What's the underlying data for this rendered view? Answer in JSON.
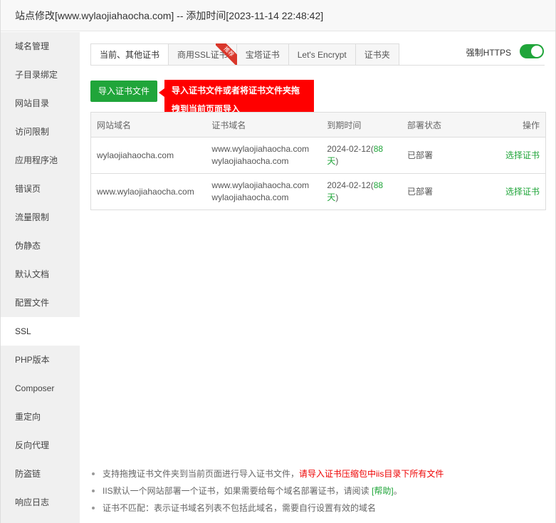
{
  "window": {
    "title": "站点修改[www.wylaojiahaocha.com] -- 添加时间[2023-11-14 22:48:42]"
  },
  "sidebar": {
    "items": [
      {
        "label": "域名管理"
      },
      {
        "label": "子目录绑定"
      },
      {
        "label": "网站目录"
      },
      {
        "label": "访问限制"
      },
      {
        "label": "应用程序池"
      },
      {
        "label": "错误页"
      },
      {
        "label": "流量限制"
      },
      {
        "label": "伪静态"
      },
      {
        "label": "默认文档"
      },
      {
        "label": "配置文件"
      },
      {
        "label": "SSL"
      },
      {
        "label": "PHP版本"
      },
      {
        "label": "Composer"
      },
      {
        "label": "重定向"
      },
      {
        "label": "反向代理"
      },
      {
        "label": "防盗链"
      },
      {
        "label": "响应日志"
      }
    ],
    "active": "SSL"
  },
  "tabs": [
    {
      "label": "当前、其他证书"
    },
    {
      "label": "商用SSL证书",
      "badge": "推荐"
    },
    {
      "label": "宝塔证书"
    },
    {
      "label": "Let's Encrypt"
    },
    {
      "label": "证书夹"
    }
  ],
  "https_toggle": {
    "label": "强制HTTPS",
    "enabled": true
  },
  "import_button": {
    "label": "导入证书文件"
  },
  "tooltip": {
    "line1": "导入证书文件或者将证书文件夹拖",
    "line2": "拽到当前页面导入"
  },
  "table": {
    "headers": {
      "site": "网站域名",
      "cert": "证书域名",
      "expire": "到期时间",
      "status": "部署状态",
      "op": "操作"
    },
    "rows": [
      {
        "site": "wylaojiahaocha.com",
        "cert1": "www.wylaojiahaocha.com",
        "cert2": "wylaojiahaocha.com",
        "expire_date": "2024-02-12(",
        "days": "88",
        "day_unit": "天",
        "close": ")",
        "status": "已部署",
        "op": "选择证书"
      },
      {
        "site": "www.wylaojiahaocha.com",
        "cert1": "www.wylaojiahaocha.com",
        "cert2": "wylaojiahaocha.com",
        "expire_date": "2024-02-12(",
        "days": "88",
        "day_unit": "天",
        "close": ")",
        "status": "已部署",
        "op": "选择证书"
      }
    ]
  },
  "notes": {
    "n1_text": "支持拖拽证书文件夹到当前页面进行导入证书文件，",
    "n1_red": "请导入证书压缩包中iis目录下所有文件",
    "n2_text": "IIS默认一个网站部署一个证书，如果需要给每个域名部署证书，请阅读 ",
    "n2_link": "[帮助]",
    "n2_end": "。",
    "n3_text": "证书不匹配：表示证书域名列表不包括此域名，需要自行设置有效的域名"
  },
  "colors": {
    "accent": "#20a53a",
    "tooltip": "#ff0000",
    "warning": "#ee0000"
  }
}
